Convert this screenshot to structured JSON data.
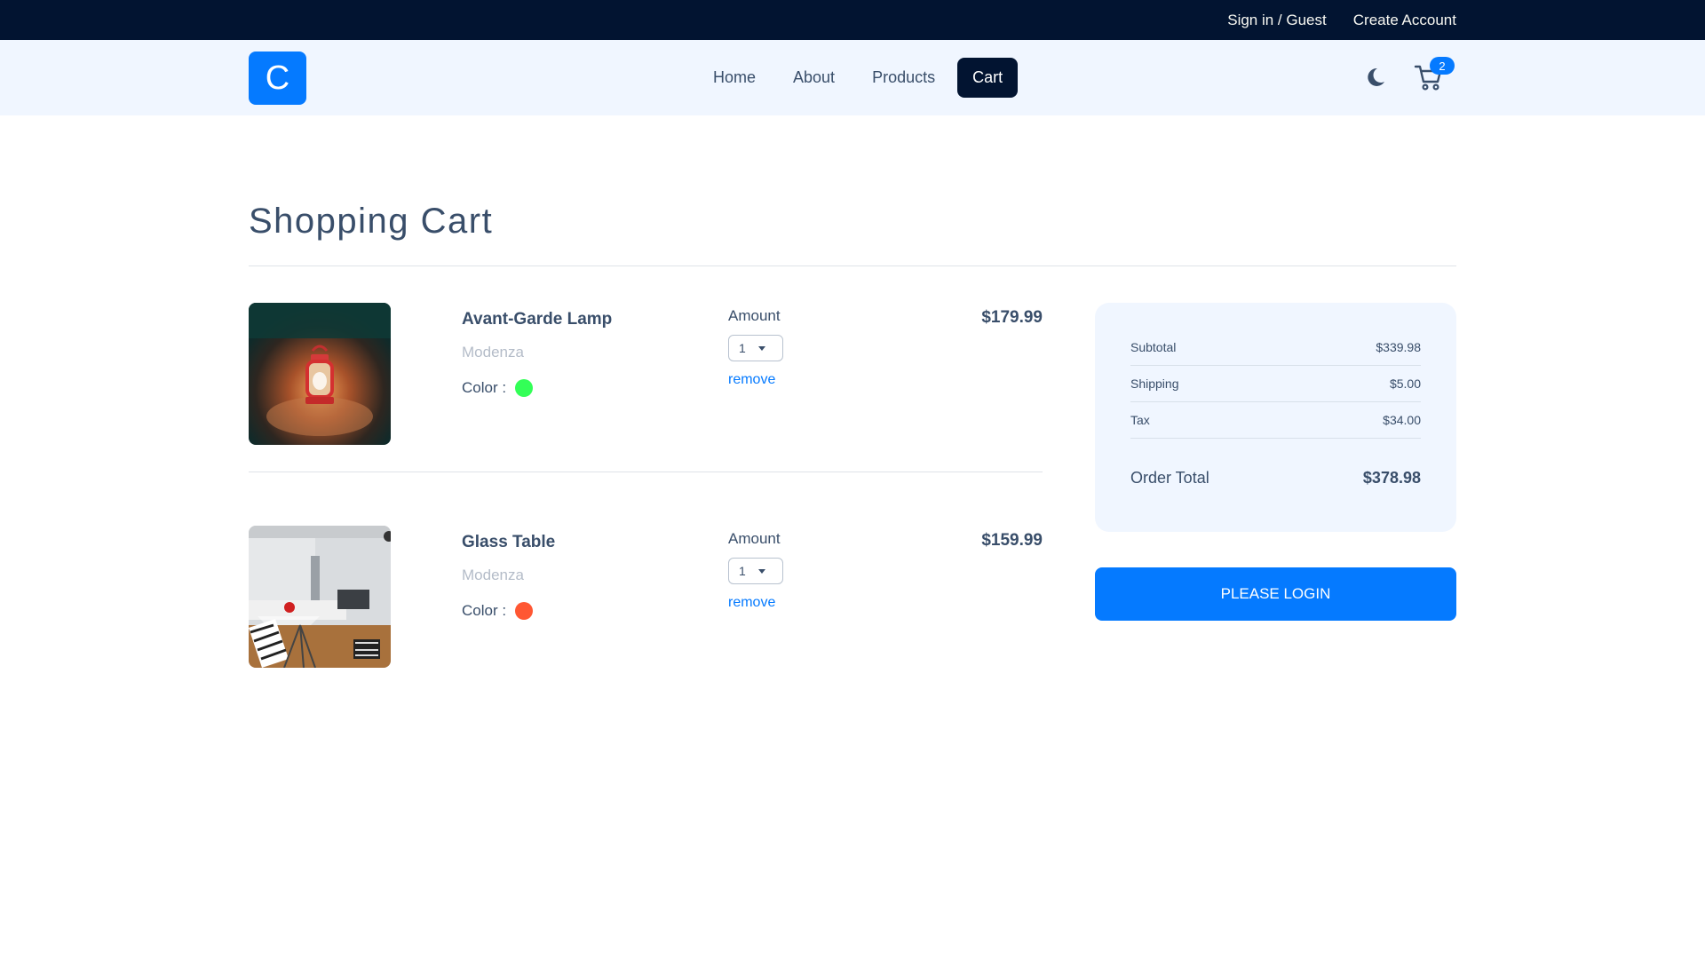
{
  "topbar": {
    "sign_in": "Sign in / Guest",
    "create_account": "Create Account"
  },
  "navbar": {
    "logo_letter": "C",
    "links": [
      {
        "label": "Home"
      },
      {
        "label": "About"
      },
      {
        "label": "Products"
      },
      {
        "label": "Cart",
        "active": true
      }
    ],
    "theme_icon": "moon-icon",
    "cart_icon": "shopping-cart-icon",
    "cart_count": "2"
  },
  "page": {
    "title": "Shopping Cart"
  },
  "cart_items": [
    {
      "name": "Avant-Garde Lamp",
      "company": "Modenza",
      "color_label": "Color :",
      "color": "#33ff57",
      "amount_label": "Amount",
      "amount": "1",
      "remove_label": "remove",
      "price": "$179.99"
    },
    {
      "name": "Glass Table",
      "company": "Modenza",
      "color_label": "Color :",
      "color": "#ff5733",
      "amount_label": "Amount",
      "amount": "1",
      "remove_label": "remove",
      "price": "$159.99"
    }
  ],
  "summary": {
    "subtotal_label": "Subtotal",
    "subtotal": "$339.98",
    "shipping_label": "Shipping",
    "shipping": "$5.00",
    "tax_label": "Tax",
    "tax": "$34.00",
    "total_label": "Order Total",
    "total": "$378.98"
  },
  "login_button": "PLEASE LOGIN",
  "colors": {
    "topbar_bg": "#021431",
    "navbar_bg": "#f0f6ff",
    "primary": "#057aff",
    "text": "#394e6a"
  }
}
